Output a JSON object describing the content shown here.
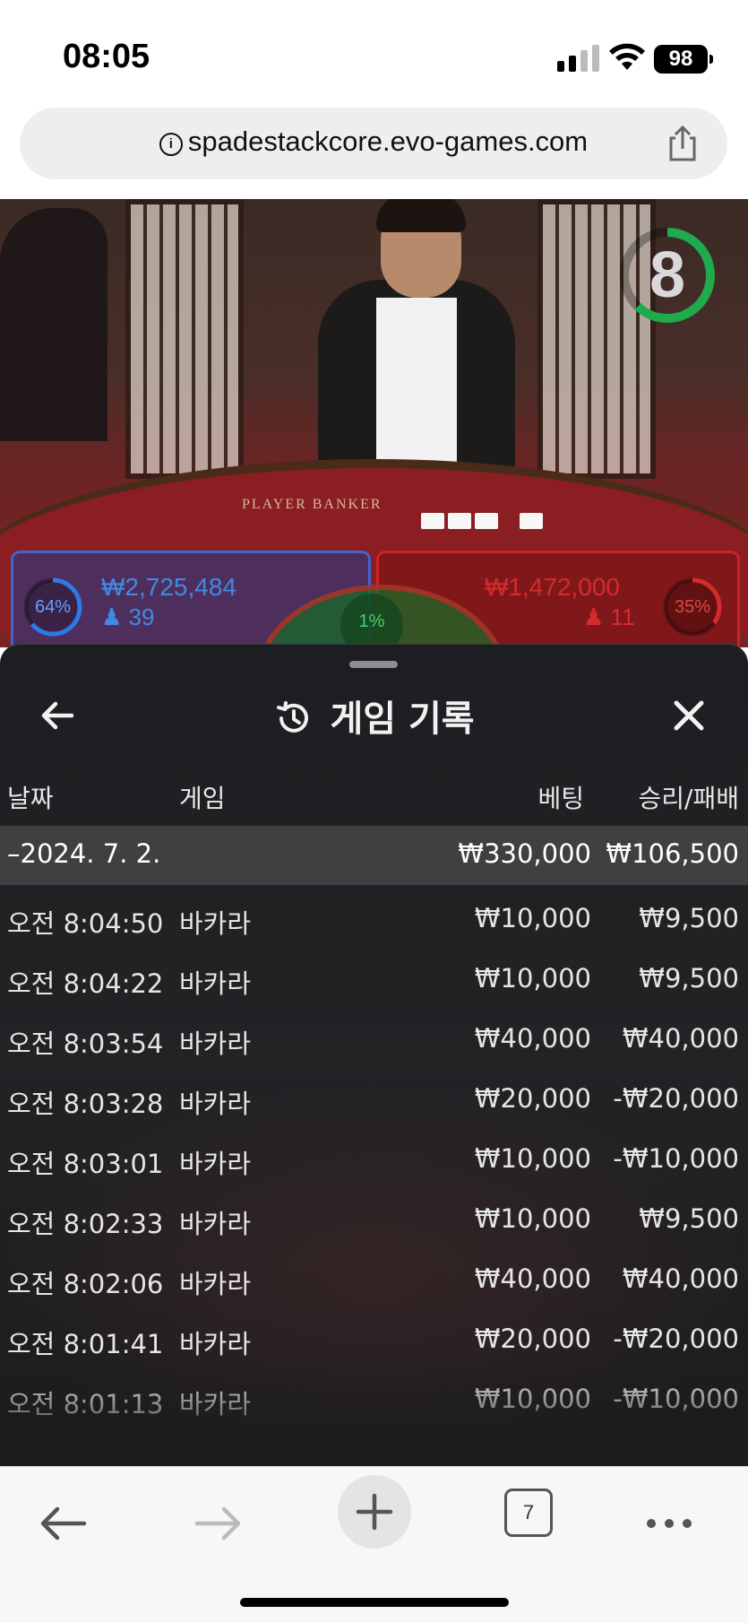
{
  "status_bar": {
    "time": "08:05",
    "battery": "98"
  },
  "browser": {
    "url": "spadestackcore.evo-games.com",
    "tab_count": "7"
  },
  "game": {
    "timer": "8",
    "table_text": "PLAYER   BANKER",
    "player": {
      "percent": "64%",
      "amount": "₩2,725,484",
      "count": "39"
    },
    "banker": {
      "percent": "35%",
      "amount": "₩1,472,000",
      "count": "11"
    },
    "tie": {
      "percent": "1%"
    },
    "colors": {
      "player": "#3f7fe0",
      "banker": "#d42b2b",
      "tie": "#2fb34e"
    }
  },
  "history": {
    "title": "게임 기록",
    "columns": {
      "date": "날짜",
      "game": "게임",
      "bet": "베팅",
      "winloss": "승리/패배"
    },
    "summary": {
      "date": "–2024. 7. 2.",
      "bet": "₩330,000",
      "winloss": "₩106,500"
    },
    "rows": [
      {
        "time": "오전 8:04:50",
        "game": "바카라",
        "bet": "₩10,000",
        "winloss": "₩9,500"
      },
      {
        "time": "오전 8:04:22",
        "game": "바카라",
        "bet": "₩10,000",
        "winloss": "₩9,500"
      },
      {
        "time": "오전 8:03:54",
        "game": "바카라",
        "bet": "₩40,000",
        "winloss": "₩40,000"
      },
      {
        "time": "오전 8:03:28",
        "game": "바카라",
        "bet": "₩20,000",
        "winloss": "-₩20,000"
      },
      {
        "time": "오전 8:03:01",
        "game": "바카라",
        "bet": "₩10,000",
        "winloss": "-₩10,000"
      },
      {
        "time": "오전 8:02:33",
        "game": "바카라",
        "bet": "₩10,000",
        "winloss": "₩9,500"
      },
      {
        "time": "오전 8:02:06",
        "game": "바카라",
        "bet": "₩40,000",
        "winloss": "₩40,000"
      },
      {
        "time": "오전 8:01:41",
        "game": "바카라",
        "bet": "₩20,000",
        "winloss": "-₩20,000"
      },
      {
        "time": "오전 8:01:13",
        "game": "바카라",
        "bet": "₩10,000",
        "winloss": "-₩10,000"
      }
    ]
  },
  "icons": {
    "back": "arrow-left-icon",
    "close": "close-icon",
    "history": "history-clock-icon",
    "nav_back": "arrow-left-icon",
    "nav_forward": "arrow-right-icon",
    "new_tab": "plus-icon",
    "more": "more-dots-icon",
    "share": "share-icon",
    "info": "info-icon"
  }
}
